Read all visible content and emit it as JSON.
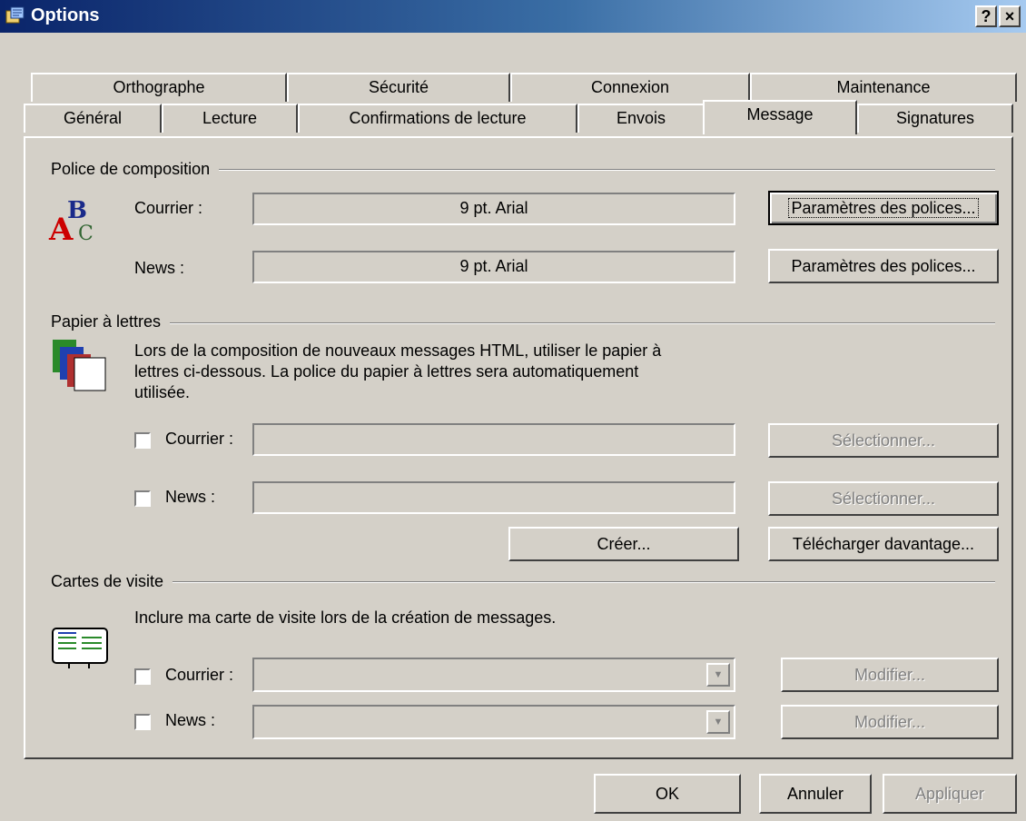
{
  "window": {
    "title": "Options",
    "help_button": "?",
    "close_button": "×"
  },
  "tabs": {
    "row1": [
      "Orthographe",
      "Sécurité",
      "Connexion",
      "Maintenance"
    ],
    "row2": [
      "Général",
      "Lecture",
      "Confirmations de lecture",
      "Envois",
      "Message",
      "Signatures"
    ],
    "active": "Message"
  },
  "police": {
    "group_label": "Police de composition",
    "courrier_label": "Courrier :",
    "courrier_value": "9 pt. Arial",
    "news_label": "News :",
    "news_value": "9 pt. Arial",
    "btn1": "Paramètres des polices...",
    "btn2": "Paramètres des polices..."
  },
  "papier": {
    "group_label": "Papier à lettres",
    "desc_line1": "Lors de la composition de nouveaux messages HTML, utiliser le papier à",
    "desc_line2": "lettres ci-dessous. La police du papier à lettres sera automatiquement",
    "desc_line3": "utilisée.",
    "courrier_label": "Courrier :",
    "courrier_value": "",
    "news_label": "News :",
    "news_value": "",
    "select1": "Sélectionner...",
    "select2": "Sélectionner...",
    "create": "Créer...",
    "download": "Télécharger davantage..."
  },
  "cartes": {
    "group_label": "Cartes de visite",
    "desc": "Inclure ma carte de visite lors de la création de messages.",
    "courrier_label": "Courrier :",
    "news_label": "News :",
    "modify1": "Modifier...",
    "modify2": "Modifier..."
  },
  "footer": {
    "ok": "OK",
    "cancel": "Annuler",
    "apply": "Appliquer"
  }
}
